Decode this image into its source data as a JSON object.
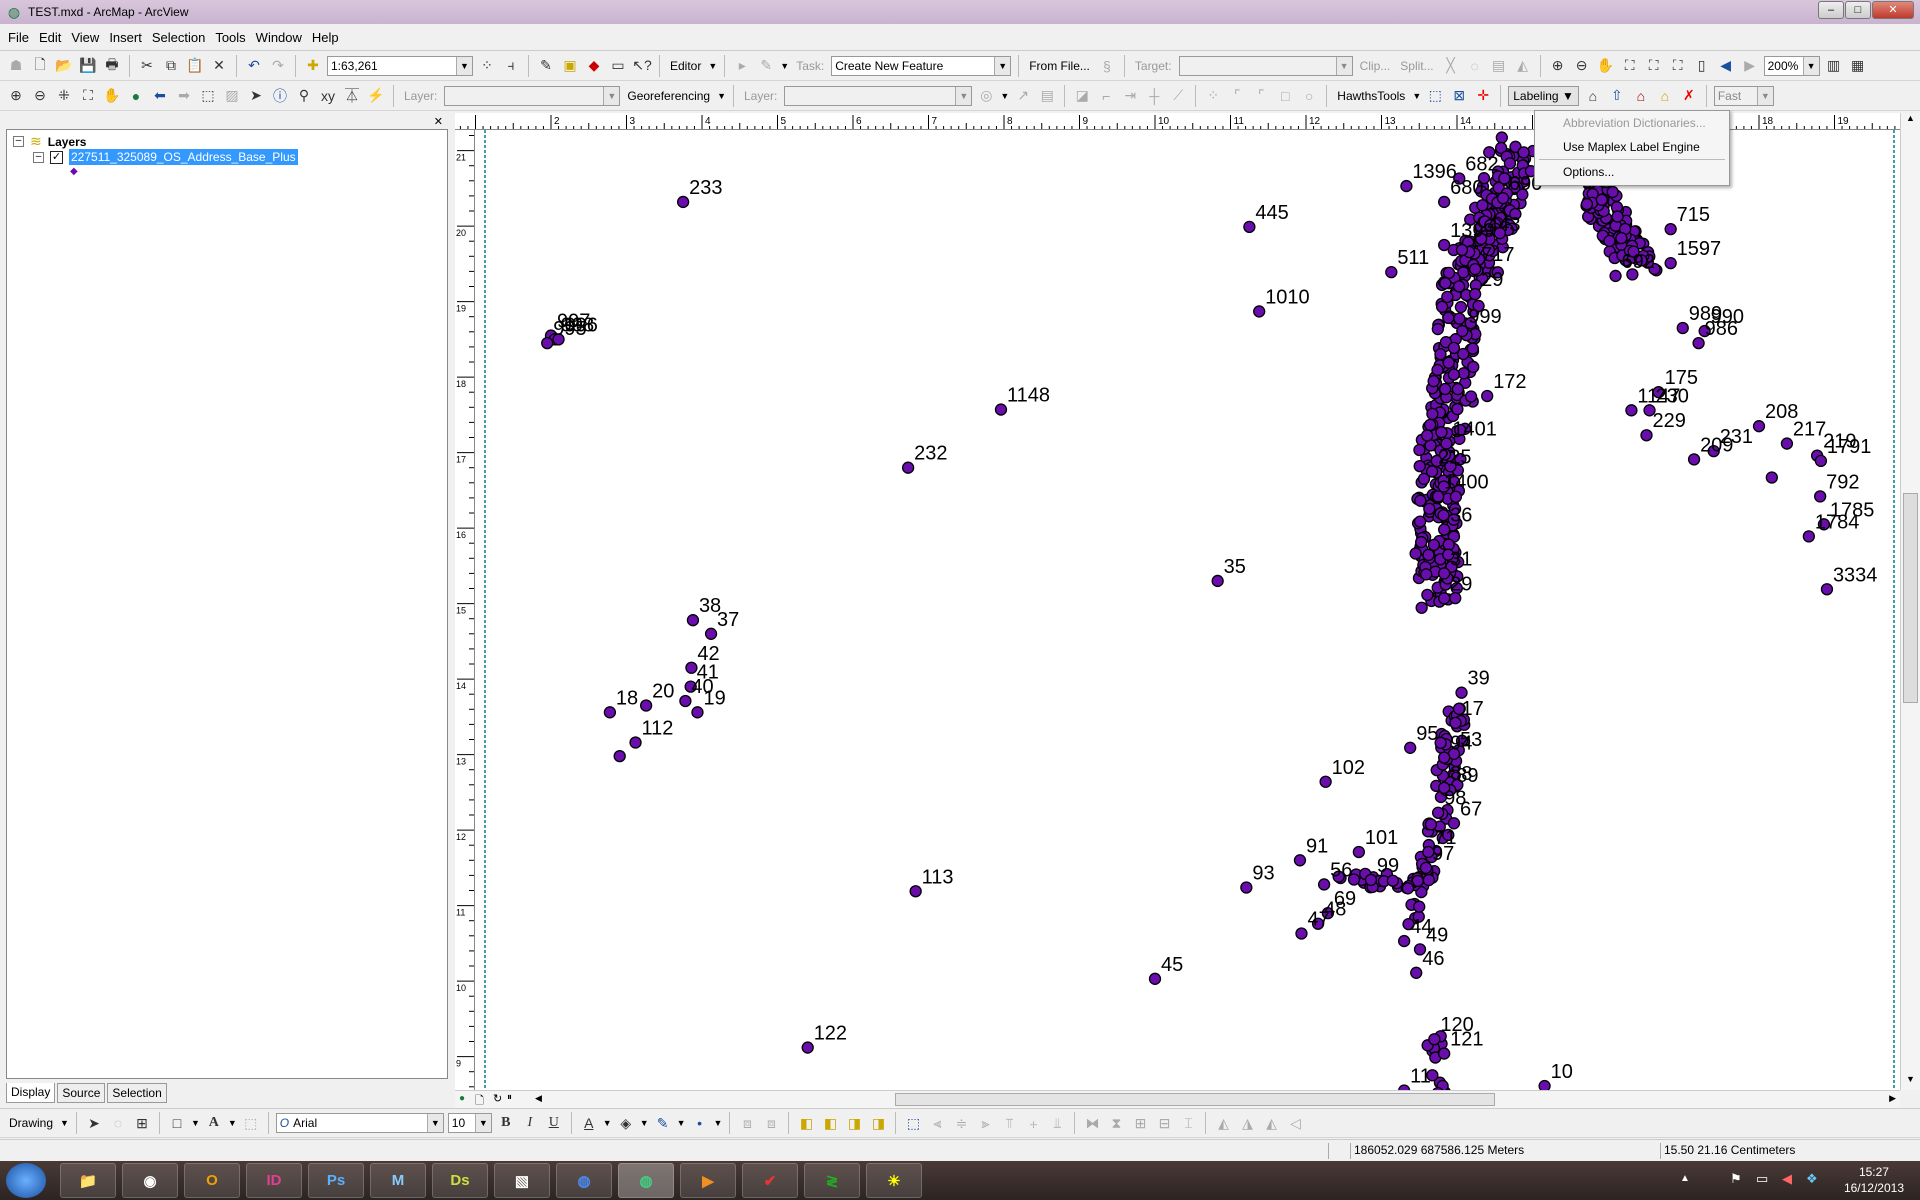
{
  "window": {
    "title": "TEST.mxd - ArcMap - ArcView",
    "icon": "arcmap-globe-icon"
  },
  "menu": [
    "File",
    "Edit",
    "View",
    "Insert",
    "Selection",
    "Tools",
    "Window",
    "Help"
  ],
  "toolbar1": {
    "scale": "1:63,261",
    "editor": "Editor",
    "task_label": "Task:",
    "task_value": "Create New Feature",
    "from_file": "From File...",
    "target_label": "Target:",
    "clip": "Clip...",
    "split": "Split...",
    "zoom": "200%"
  },
  "toolbar2": {
    "layer_label": "Layer:",
    "georef": "Georeferencing",
    "layer_label2": "Layer:",
    "hawths": "HawthsTools",
    "labeling": "Labeling",
    "fast": "Fast"
  },
  "labeling_menu": [
    {
      "label": "Abbreviation Dictionaries...",
      "enabled": false
    },
    {
      "label": "Use Maplex Label Engine",
      "enabled": true
    },
    {
      "label": "Options...",
      "enabled": true
    }
  ],
  "toc": {
    "root": "Layers",
    "layer": "227511_325089_OS_Address_Base_Plus",
    "layer_checked": true,
    "symbol_color": "#6a0dad",
    "tabs": [
      "Display",
      "Source",
      "Selection"
    ]
  },
  "rulers": {
    "units": "cm",
    "top": [
      2,
      3,
      4,
      5,
      6,
      7,
      8,
      9,
      10,
      11,
      12,
      13,
      14,
      15,
      16,
      17,
      18,
      19
    ],
    "left": [
      21,
      20,
      19,
      18,
      17,
      16,
      15,
      14,
      13,
      12,
      11,
      10,
      9
    ]
  },
  "map": {
    "point_fill": "#6a0dad",
    "point_stroke": "#000000",
    "points": [
      [
        "233",
        3.75,
        20.32
      ],
      [
        "445",
        11.25,
        19.99
      ],
      [
        "1010",
        11.38,
        18.87
      ],
      [
        "997",
        2.0,
        18.55
      ],
      [
        "998",
        2.05,
        18.5
      ],
      [
        "995",
        1.95,
        18.45
      ],
      [
        "996",
        2.1,
        18.5
      ],
      [
        "1148",
        7.96,
        17.57
      ],
      [
        "232",
        6.73,
        16.8
      ],
      [
        "35",
        10.83,
        15.3
      ],
      [
        "38",
        3.88,
        14.78
      ],
      [
        "37",
        4.12,
        14.6
      ],
      [
        "42",
        3.86,
        14.15
      ],
      [
        "20",
        3.26,
        13.65
      ],
      [
        "18",
        2.78,
        13.56
      ],
      [
        "40",
        3.78,
        13.71
      ],
      [
        "19",
        3.94,
        13.56
      ],
      [
        "112",
        3.12,
        13.16
      ],
      [
        "",
        2.91,
        12.98
      ],
      [
        "41",
        3.85,
        13.9
      ],
      [
        "113",
        6.83,
        11.19
      ],
      [
        "45",
        10.0,
        10.03
      ],
      [
        "122",
        5.4,
        9.12
      ],
      [
        "10",
        15.16,
        8.61
      ],
      [
        "102",
        12.26,
        12.64
      ],
      [
        "1396",
        13.33,
        20.53
      ],
      [
        "682",
        14.03,
        20.63
      ],
      [
        "690",
        14.61,
        20.37
      ],
      [
        "680",
        13.83,
        20.32
      ],
      [
        "1399",
        13.83,
        19.75
      ],
      [
        "443",
        14.32,
        19.83
      ],
      [
        "511",
        13.13,
        19.39
      ],
      [
        "717",
        14.24,
        19.43
      ],
      [
        "29",
        14.24,
        19.1
      ],
      [
        "999",
        14.07,
        18.61
      ],
      [
        "172",
        14.4,
        17.75
      ],
      [
        "1401",
        13.86,
        17.12
      ],
      [
        "225",
        13.67,
        16.75
      ],
      [
        "1400",
        13.75,
        16.42
      ],
      [
        "36",
        13.83,
        15.98
      ],
      [
        "31",
        13.83,
        15.4
      ],
      [
        "29",
        13.83,
        15.07
      ],
      [
        "715",
        16.83,
        19.96
      ],
      [
        "1597",
        16.83,
        19.51
      ],
      [
        "692",
        16.1,
        19.34
      ],
      [
        "989",
        16.99,
        18.65
      ],
      [
        "990",
        17.28,
        18.61
      ],
      [
        "986",
        17.2,
        18.45
      ],
      [
        "1147",
        16.31,
        17.56
      ],
      [
        "175",
        16.67,
        17.8
      ],
      [
        "230",
        16.55,
        17.56
      ],
      [
        "229",
        16.51,
        17.23
      ],
      [
        "231",
        17.4,
        17.02
      ],
      [
        "209",
        17.14,
        16.91
      ],
      [
        "208",
        18.0,
        17.35
      ],
      [
        "217",
        18.37,
        17.12
      ],
      [
        "219",
        18.77,
        16.96
      ],
      [
        "1791",
        18.82,
        16.89
      ],
      [
        "792",
        18.81,
        16.42
      ],
      [
        "1784",
        18.66,
        15.89
      ],
      [
        "1785",
        18.86,
        16.05
      ],
      [
        "3334",
        18.9,
        15.19
      ],
      [
        "",
        18.17,
        16.67
      ],
      [
        "39",
        14.06,
        13.82
      ],
      [
        "17",
        13.98,
        13.42
      ],
      [
        "53",
        13.96,
        13.01
      ],
      [
        "95",
        13.38,
        13.09
      ],
      [
        "94",
        13.83,
        12.96
      ],
      [
        "89",
        13.91,
        12.53
      ],
      [
        "88",
        13.83,
        12.56
      ],
      [
        "67",
        13.96,
        12.09
      ],
      [
        "98",
        13.75,
        12.23
      ],
      [
        "71",
        13.62,
        11.71
      ],
      [
        "101",
        12.7,
        11.71
      ],
      [
        "91",
        11.92,
        11.6
      ],
      [
        "97",
        13.59,
        11.5
      ],
      [
        "56",
        12.24,
        11.28
      ],
      [
        "99",
        12.86,
        11.34
      ],
      [
        "93",
        11.21,
        11.24
      ],
      [
        "69",
        12.29,
        10.9
      ],
      [
        "48",
        12.16,
        10.76
      ],
      [
        "47",
        11.94,
        10.63
      ],
      [
        "44",
        13.3,
        10.53
      ],
      [
        "49",
        13.51,
        10.42
      ],
      [
        "46",
        13.46,
        10.11
      ],
      [
        "120",
        13.7,
        9.23
      ],
      [
        "121",
        13.83,
        9.04
      ],
      [
        "11",
        13.3,
        8.55
      ]
    ]
  },
  "drawing": {
    "label": "Drawing",
    "font": "Arial",
    "size": "10"
  },
  "status": {
    "coords": "186052.029  687586.125 Meters",
    "page": "15.50  21.16 Centimeters"
  },
  "taskbar": {
    "apps": [
      "explorer",
      "chrome",
      "outlook",
      "ID",
      "Ps",
      "3ds",
      "DS",
      "photos",
      "google-earth",
      "arcmap",
      "media",
      "app",
      "app",
      "app"
    ],
    "time": "15:27",
    "date": "16/12/2013"
  }
}
